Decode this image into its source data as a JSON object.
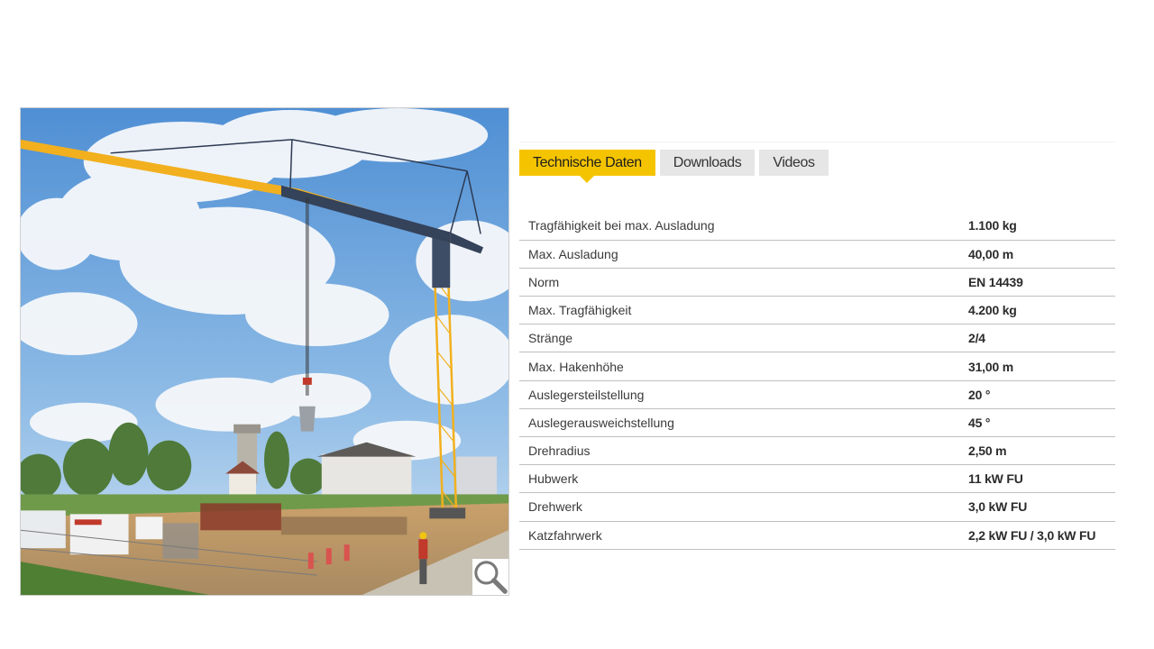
{
  "photo": {
    "alt_subject": "crane",
    "zoom_icon": "magnifier-icon"
  },
  "tabs": [
    {
      "label": "Technische Daten",
      "active": true
    },
    {
      "label": "Downloads",
      "active": false
    },
    {
      "label": "Videos",
      "active": false
    }
  ],
  "specs": [
    {
      "label": "Tragfähigkeit bei max. Ausladung",
      "value": "1.100 kg"
    },
    {
      "label": "Max. Ausladung",
      "value": "40,00 m"
    },
    {
      "label": "Norm",
      "value": "EN 14439"
    },
    {
      "label": "Max. Tragfähigkeit",
      "value": "4.200 kg"
    },
    {
      "label": "Stränge",
      "value": "2/4"
    },
    {
      "label": "Max. Hakenhöhe",
      "value": "31,00 m"
    },
    {
      "label": "Auslegersteilstellung",
      "value": "20 °"
    },
    {
      "label": "Auslegerausweichstellung",
      "value": "45 °"
    },
    {
      "label": "Drehradius",
      "value": "2,50 m"
    },
    {
      "label": "Hubwerk",
      "value": "11 kW FU"
    },
    {
      "label": "Drehwerk",
      "value": "3,0 kW FU"
    },
    {
      "label": "Katzfahrwerk",
      "value": "2,2 kW FU / 3,0 kW FU"
    }
  ],
  "colors": {
    "accent": "#f5c400",
    "tab_inactive": "#e6e6e6",
    "row_divider": "#bfbfbf"
  }
}
